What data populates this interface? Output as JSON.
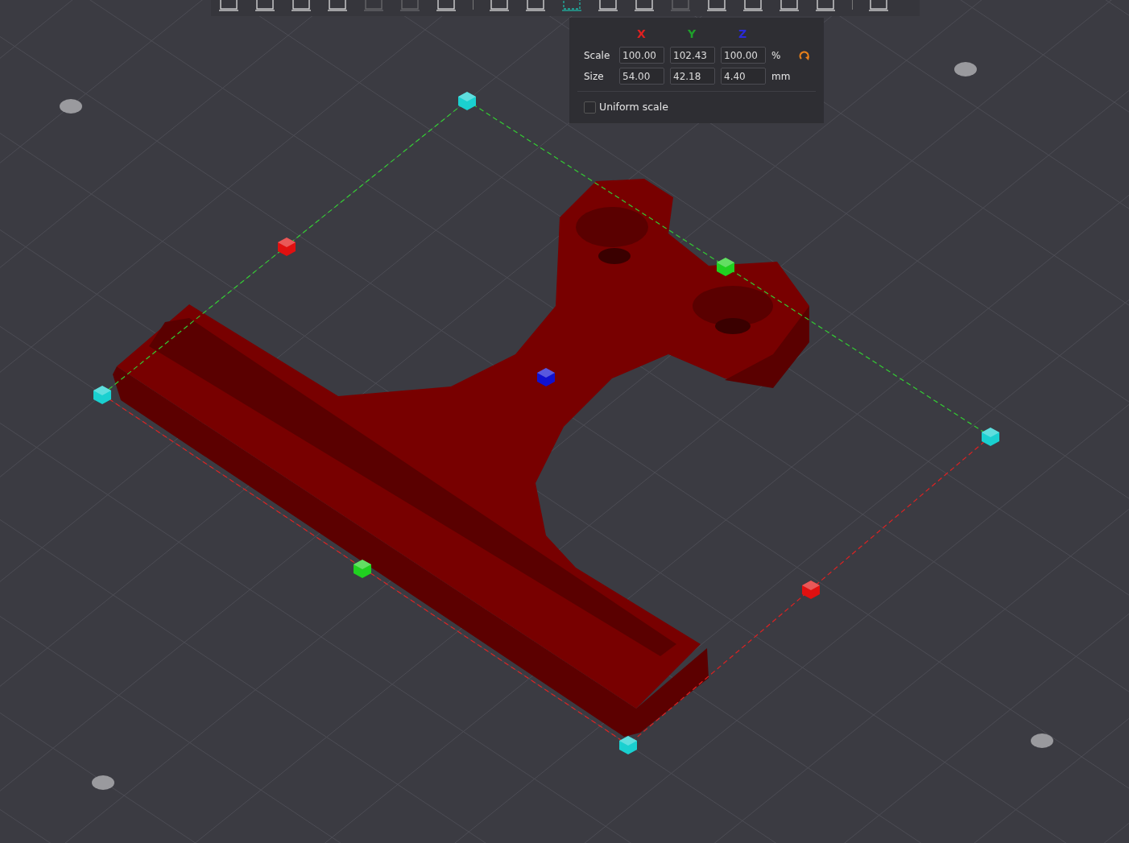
{
  "toolbar": {
    "tools": [
      {
        "kind": "tool",
        "selected": false,
        "disabled": false
      },
      {
        "kind": "tool",
        "selected": false,
        "disabled": false
      },
      {
        "kind": "tool",
        "selected": false,
        "disabled": false
      },
      {
        "kind": "tool",
        "selected": false,
        "disabled": false
      },
      {
        "kind": "tool",
        "selected": false,
        "disabled": true
      },
      {
        "kind": "tool",
        "selected": false,
        "disabled": true
      },
      {
        "kind": "tool",
        "selected": false,
        "disabled": false
      },
      {
        "kind": "separator"
      },
      {
        "kind": "tool",
        "selected": false,
        "disabled": false
      },
      {
        "kind": "tool",
        "selected": false,
        "disabled": false
      },
      {
        "kind": "tool",
        "selected": true,
        "disabled": false
      },
      {
        "kind": "tool",
        "selected": false,
        "disabled": false
      },
      {
        "kind": "tool",
        "selected": false,
        "disabled": false
      },
      {
        "kind": "tool",
        "selected": false,
        "disabled": true
      },
      {
        "kind": "tool",
        "selected": false,
        "disabled": false
      },
      {
        "kind": "tool",
        "selected": false,
        "disabled": false
      },
      {
        "kind": "tool",
        "selected": false,
        "disabled": false
      },
      {
        "kind": "tool",
        "selected": false,
        "disabled": false
      },
      {
        "kind": "separator"
      },
      {
        "kind": "tool",
        "selected": false,
        "disabled": false
      }
    ]
  },
  "scale_panel": {
    "axes": [
      {
        "label": "X",
        "color": "#e02020"
      },
      {
        "label": "Y",
        "color": "#1ea02a"
      },
      {
        "label": "Z",
        "color": "#2a2ad8"
      }
    ],
    "rows": [
      {
        "label": "Scale",
        "values": [
          "100.00",
          "102.43",
          "100.00"
        ],
        "unit": "%",
        "reset": true
      },
      {
        "label": "Size",
        "values": [
          "54.00",
          "42.18",
          "4.40"
        ],
        "unit": "mm",
        "reset": false
      }
    ],
    "uniform_scale": {
      "label": "Uniform scale",
      "checked": false
    }
  }
}
